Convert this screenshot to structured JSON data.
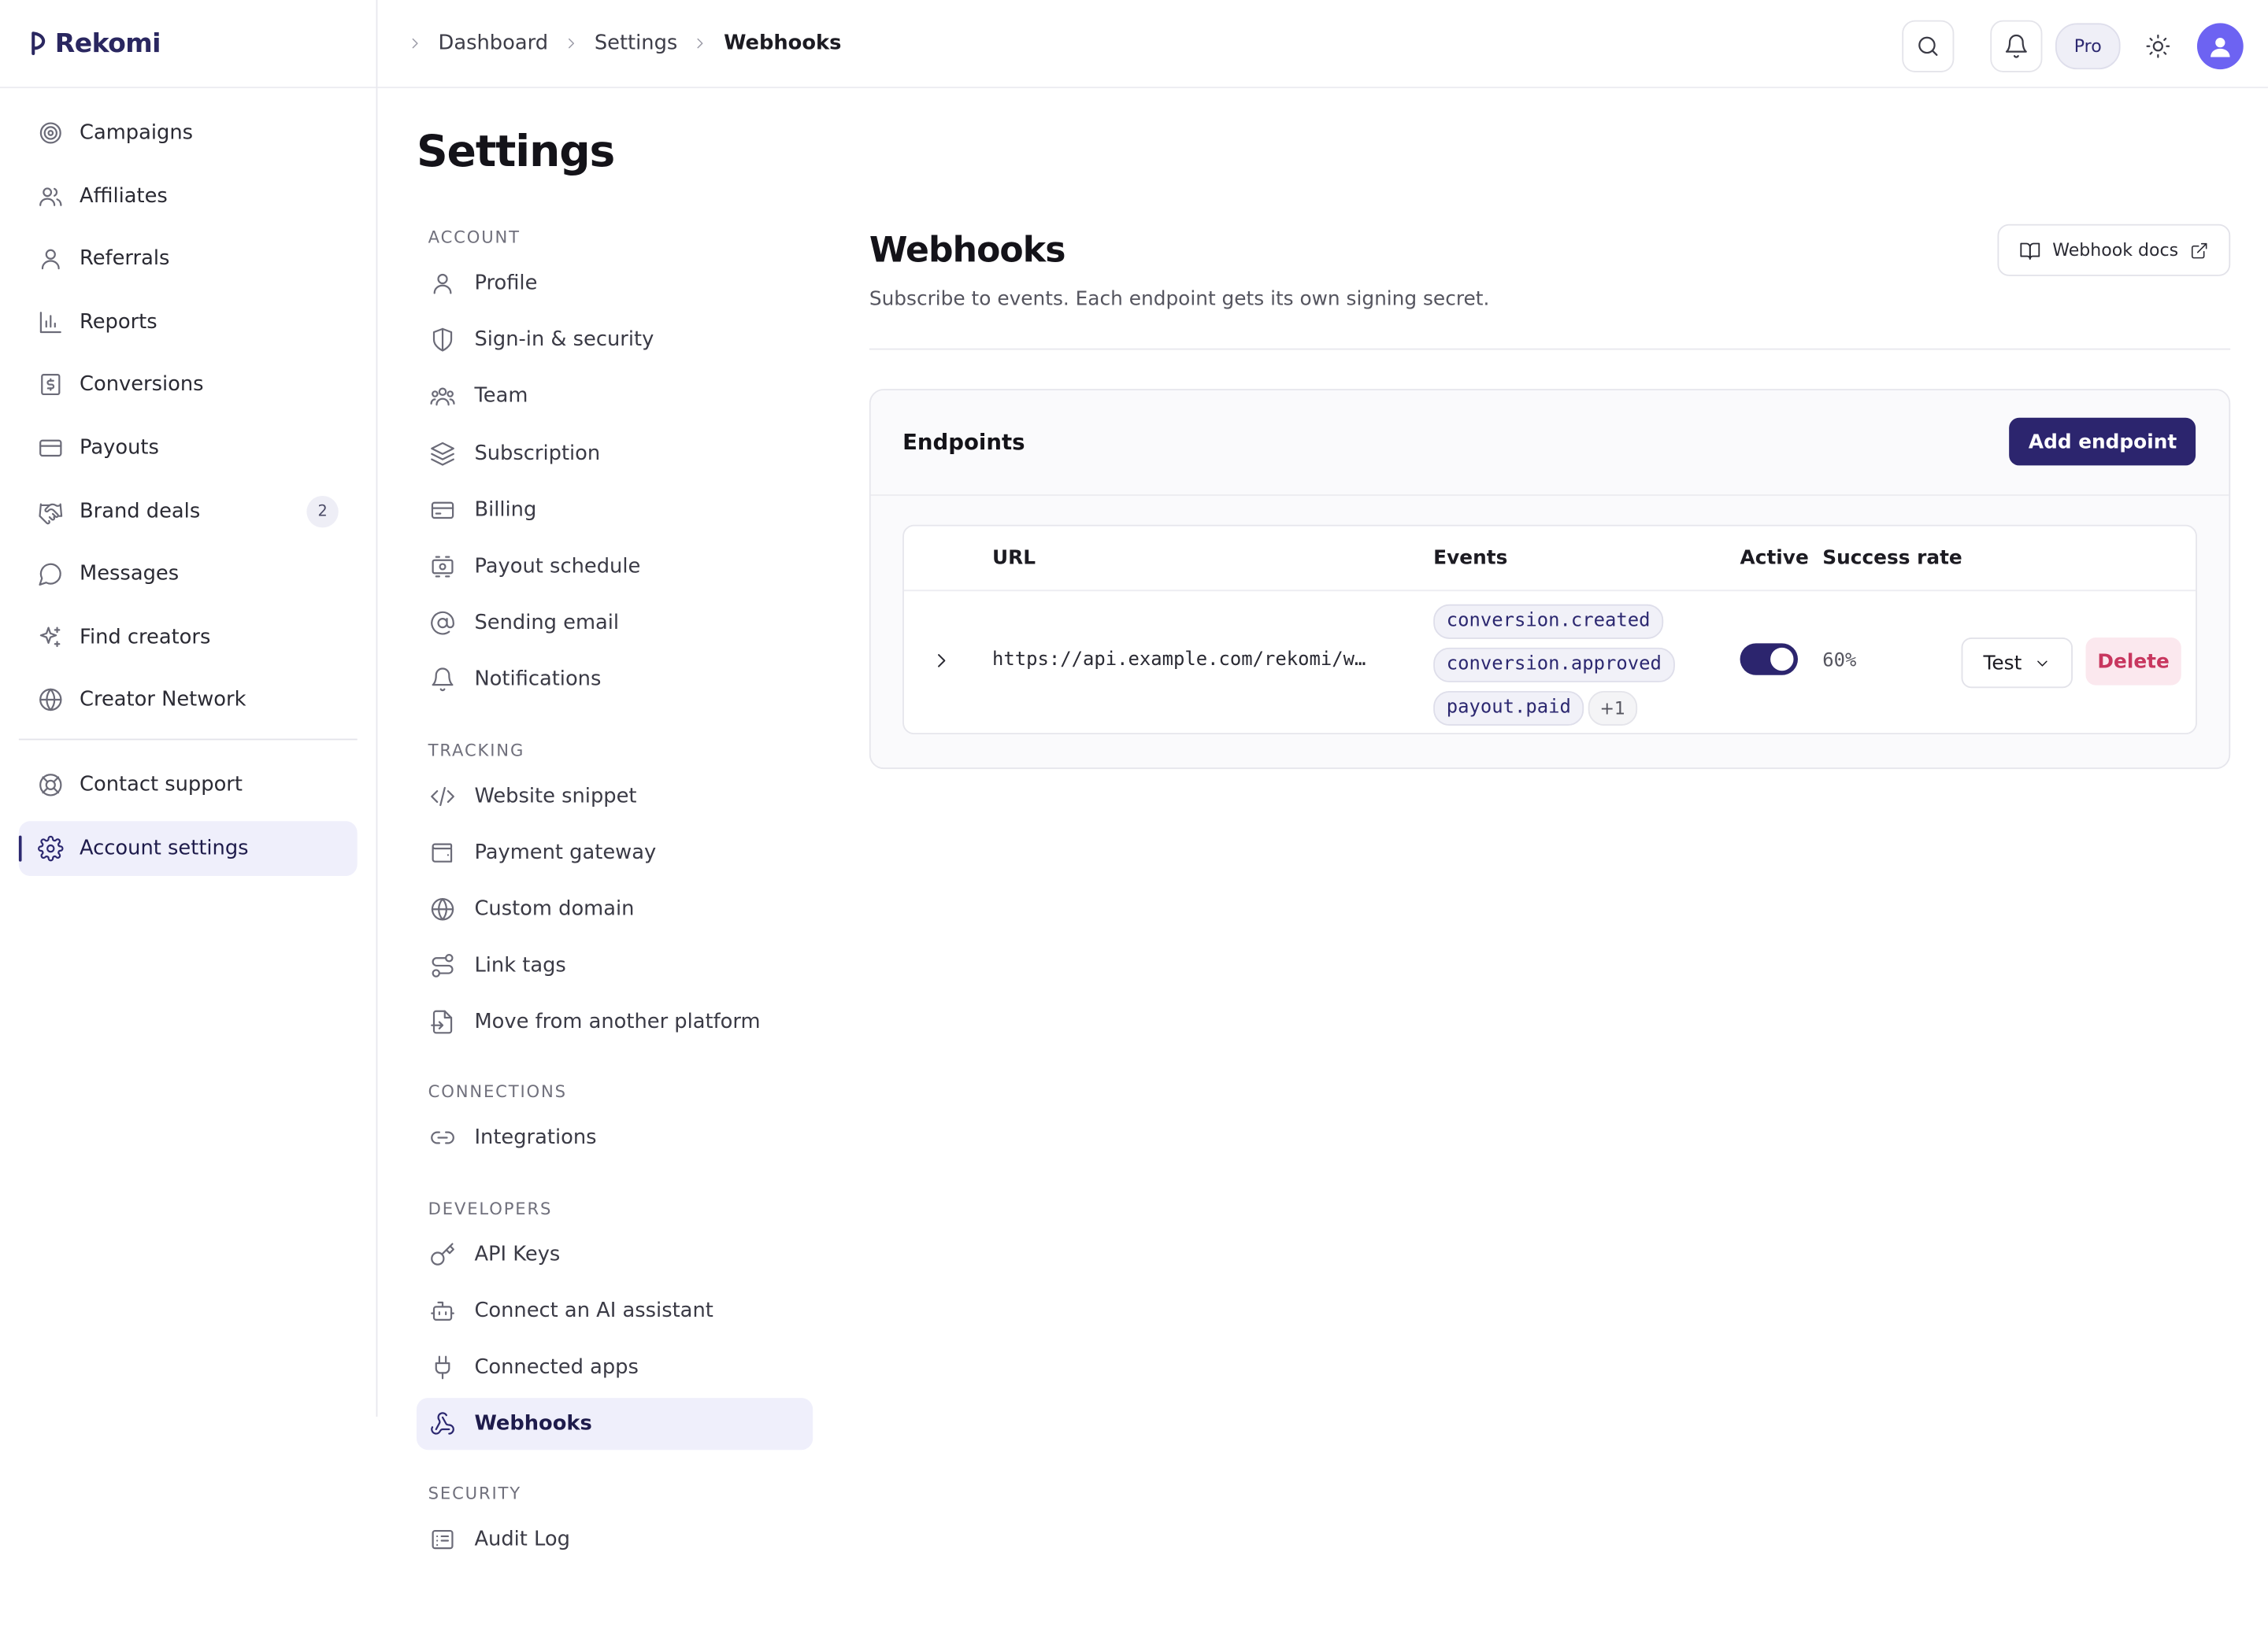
{
  "brand": {
    "name": "Rekomi"
  },
  "sidebar": {
    "items": [
      {
        "label": "Campaigns",
        "icon": "target-icon"
      },
      {
        "label": "Affiliates",
        "icon": "users-icon"
      },
      {
        "label": "Referrals",
        "icon": "user-icon"
      },
      {
        "label": "Reports",
        "icon": "bar-chart-icon"
      },
      {
        "label": "Conversions",
        "icon": "receipt-icon"
      },
      {
        "label": "Payouts",
        "icon": "credit-card-icon"
      },
      {
        "label": "Brand deals",
        "icon": "handshake-icon",
        "badge": "2"
      },
      {
        "label": "Messages",
        "icon": "chat-icon"
      },
      {
        "label": "Find creators",
        "icon": "sparkles-icon"
      },
      {
        "label": "Creator Network",
        "icon": "globe-icon"
      }
    ],
    "footer": [
      {
        "label": "Contact support",
        "icon": "lifebuoy-icon"
      },
      {
        "label": "Account settings",
        "icon": "gear-icon",
        "active": true
      }
    ]
  },
  "breadcrumb": [
    "Dashboard",
    "Settings",
    "Webhooks"
  ],
  "topbar": {
    "plan": "Pro"
  },
  "settings": {
    "title": "Settings",
    "sections": [
      {
        "title": "ACCOUNT",
        "items": [
          "Profile",
          "Sign-in & security",
          "Team",
          "Subscription",
          "Billing",
          "Payout schedule",
          "Sending email",
          "Notifications"
        ]
      },
      {
        "title": "TRACKING",
        "items": [
          "Website snippet",
          "Payment gateway",
          "Custom domain",
          "Link tags",
          "Move from another platform"
        ]
      },
      {
        "title": "CONNECTIONS",
        "items": [
          "Integrations"
        ]
      },
      {
        "title": "DEVELOPERS",
        "items": [
          "API Keys",
          "Connect an AI assistant",
          "Connected apps",
          "Webhooks"
        ]
      },
      {
        "title": "SECURITY",
        "items": [
          "Audit Log"
        ]
      }
    ]
  },
  "webhooks": {
    "title": "Webhooks",
    "subtitle": "Subscribe to events. Each endpoint gets its own signing secret.",
    "docs_label": "Webhook docs",
    "card_title": "Endpoints",
    "add_label": "Add endpoint",
    "columns": [
      "URL",
      "Events",
      "Active",
      "Success rate"
    ],
    "rows": [
      {
        "url": "https://api.example.com/rekomi/w…",
        "events": [
          "conversion.created",
          "conversion.approved",
          "payout.paid"
        ],
        "more": "+1",
        "active": true,
        "success_rate": "60%",
        "test_label": "Test",
        "delete_label": "Delete"
      }
    ]
  },
  "colors": {
    "accent": "#2c256e",
    "danger": "#c8375f",
    "active_bg": "#efeffb"
  }
}
